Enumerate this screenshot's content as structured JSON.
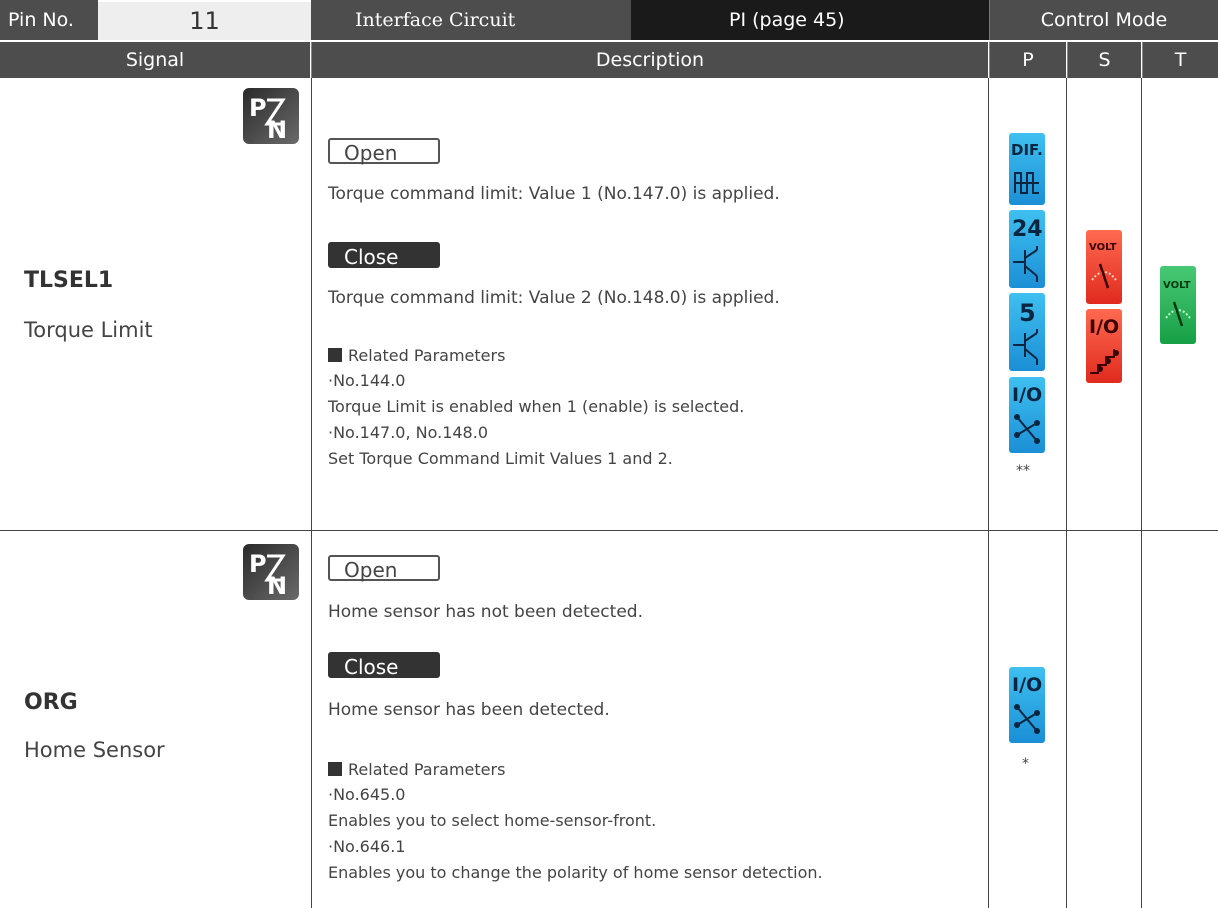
{
  "header": {
    "pin_label": "Pin No.",
    "pin_value": "11",
    "interface_label": "Interface Circuit",
    "interface_value": "PI  (page 45)",
    "control_mode": "Control Mode",
    "signal": "Signal",
    "description": "Description",
    "col_p": "P",
    "col_s": "S",
    "col_t": "T"
  },
  "rows": [
    {
      "signal_name": "TLSEL1",
      "signal_desc": "Torque Limit",
      "open_label": "Open",
      "open_text": "Torque command limit: Value 1 (No.147.0) is applied.",
      "close_label": "Close",
      "close_text": "Torque command limit: Value 2 (No.148.0) is applied.",
      "related_title": "Related Parameters",
      "params": [
        {
          "name": "·No.144.0",
          "text": "Torque Limit is enabled when 1 (enable) is selected."
        },
        {
          "name": "·No.147.0, No.148.0",
          "text": "Set Torque Command Limit Values 1 and 2."
        }
      ],
      "p_note": "**",
      "p_icons": [
        "dif-pulse-icon",
        "24v-transistor-icon",
        "5v-transistor-icon",
        "io-switch-icon"
      ],
      "s_icons": [
        "volt-meter-icon",
        "io-step-icon"
      ],
      "t_icons": [
        "volt-meter-icon"
      ]
    },
    {
      "signal_name": "ORG",
      "signal_desc": "Home Sensor",
      "open_label": "Open",
      "open_text": "Home sensor has not been detected.",
      "close_label": "Close",
      "close_text": "Home sensor has been detected.",
      "related_title": "Related Parameters",
      "params": [
        {
          "name": "·No.645.0",
          "text": "Enables you to select home-sensor-front."
        },
        {
          "name": "·No.646.1",
          "text": "Enables you to change the polarity of home sensor detection."
        }
      ],
      "p_note": "*",
      "p_icons": [
        "io-switch-icon"
      ]
    }
  ],
  "colors": {
    "header_bg": "#4d4d4d",
    "pin_bg": "#eeeeee",
    "interface_value_bg": "#1a1a1a",
    "blue": "#1b8fd6",
    "red": "#e02a1f",
    "green": "#18a046"
  },
  "icon_text": {
    "dif": "DIF.",
    "v24": "24",
    "v5": "5",
    "io": "I/O",
    "volt": "VOLT"
  }
}
